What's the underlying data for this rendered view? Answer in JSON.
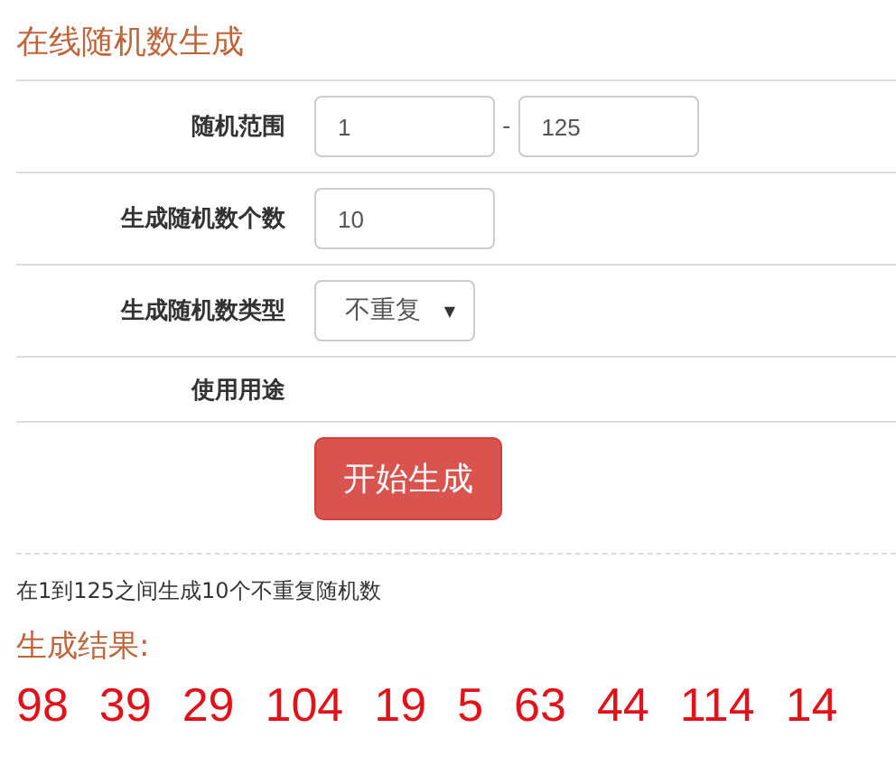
{
  "title": "在线随机数生成",
  "fields": [
    {
      "label": "随机范围",
      "kind": "range",
      "from": "1",
      "separator": "-",
      "to": "125"
    },
    {
      "label": "生成随机数个数",
      "kind": "number",
      "value": "10"
    },
    {
      "label": "生成随机数类型",
      "kind": "select",
      "value": "不重复",
      "caret": "▼"
    },
    {
      "label": "使用用途",
      "kind": "empty"
    }
  ],
  "button": "开始生成",
  "summary": "在1到125之间生成10个不重复随机数",
  "result_title": "生成结果:",
  "results": [
    "98",
    "39",
    "29",
    "104",
    "19",
    "5",
    "63",
    "44",
    "114",
    "14"
  ]
}
